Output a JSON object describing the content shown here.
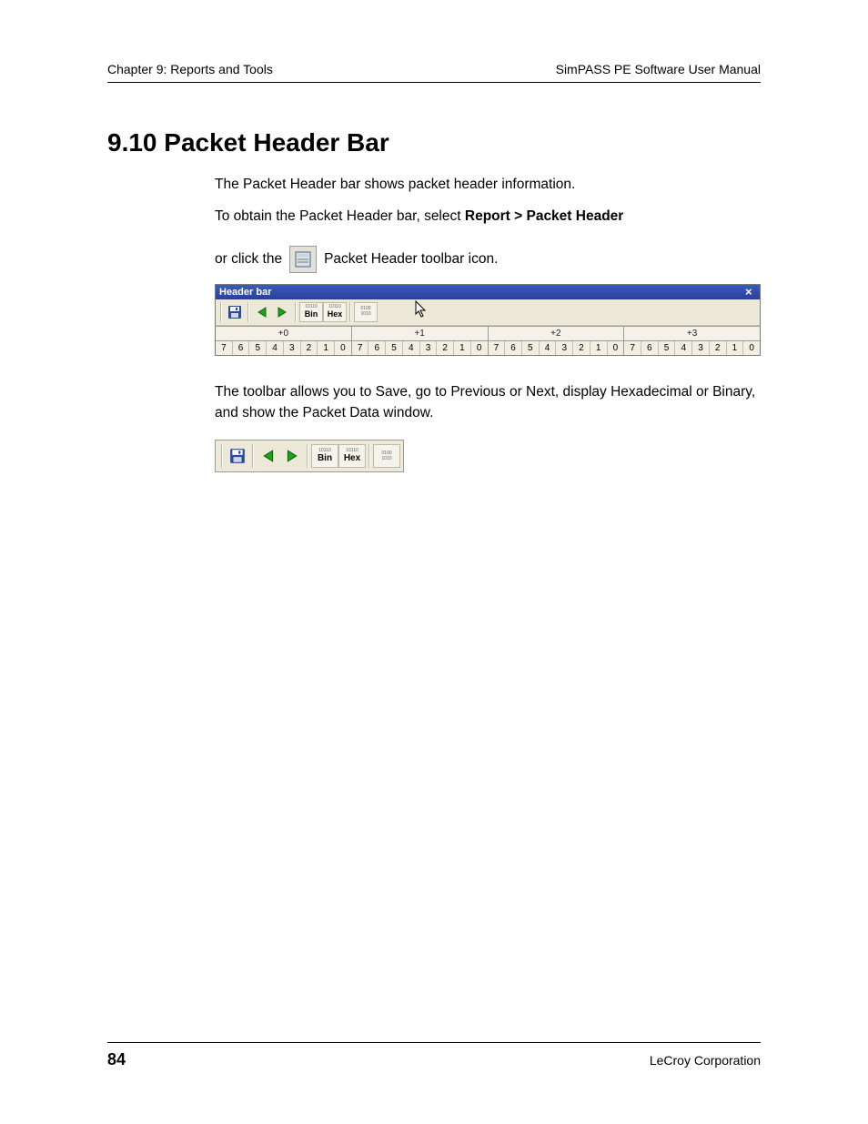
{
  "header": {
    "left": "Chapter 9: Reports and Tools",
    "right": "SimPASS PE Software User Manual"
  },
  "title": "9.10 Packet Header Bar",
  "para1": "The Packet Header bar shows packet header information.",
  "para2_pre": "To obtain the Packet Header bar, select ",
  "para2_bold": "Report > Packet Header",
  "para3_pre": "or click the ",
  "para3_post": " Packet Header toolbar icon.",
  "headerbar": {
    "title": "Header bar",
    "close_glyph": "×",
    "toolbar": {
      "save": "save",
      "prev": "prev",
      "next": "next",
      "bin_top": "10110",
      "bin_label": "Bin",
      "hex_top": "10110",
      "hex_label": "Hex",
      "data_top": "0100",
      "data_bottom": "1010"
    },
    "groups": [
      {
        "label": "+0",
        "bits": [
          "7",
          "6",
          "5",
          "4",
          "3",
          "2",
          "1",
          "0"
        ]
      },
      {
        "label": "+1",
        "bits": [
          "7",
          "6",
          "5",
          "4",
          "3",
          "2",
          "1",
          "0"
        ]
      },
      {
        "label": "+2",
        "bits": [
          "7",
          "6",
          "5",
          "4",
          "3",
          "2",
          "1",
          "0"
        ]
      },
      {
        "label": "+3",
        "bits": [
          "7",
          "6",
          "5",
          "4",
          "3",
          "2",
          "1",
          "0"
        ]
      }
    ]
  },
  "para4_pre": "The toolbar allows you to ",
  "para4_rest": "Save, go to Previous or Next, display Hexadecimal or Binary, and show the Packet Data window.",
  "footer": {
    "page": "84",
    "corp": "LeCroy Corporation"
  }
}
